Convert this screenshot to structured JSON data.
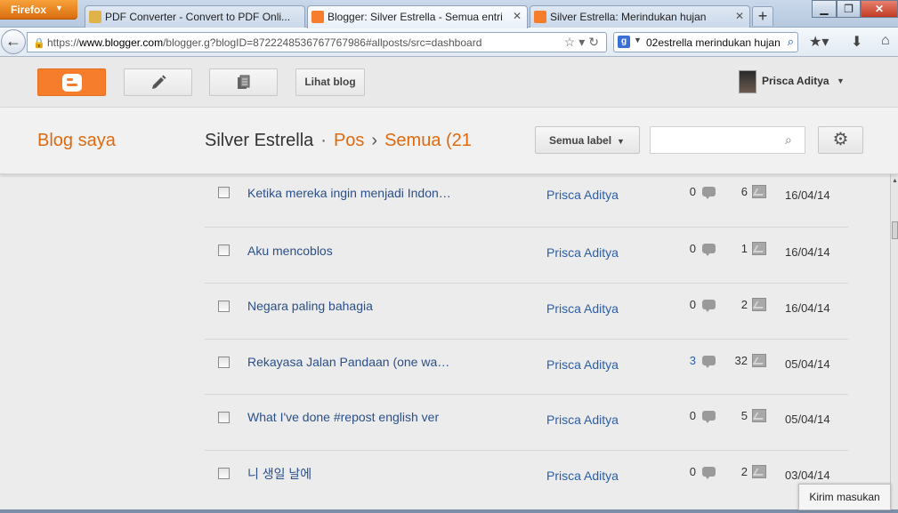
{
  "browser": {
    "menu_label": "Firefox",
    "tabs": [
      {
        "label": "PDF Converter - Convert to PDF Onli...",
        "favicon_color": "#e0b24a"
      },
      {
        "label": "Blogger: Silver Estrella - Semua entri",
        "favicon_color": "#f57d2c"
      },
      {
        "label": "Silver Estrella: Merindukan hujan",
        "favicon_color": "#f57d2c"
      }
    ],
    "url_prefix": "https://",
    "url_host": "www.blogger.com",
    "url_path": "/blogger.g?blogID=8722248536767767986#allposts/src=dashboard",
    "search_value": "02estrella merindukan hujan",
    "accent": "#f57d2c"
  },
  "header": {
    "view_blog_label": "Lihat blog",
    "user_name": "Prisca Aditya"
  },
  "subheader": {
    "my_blogs": "Blog saya",
    "blog_name": "Silver Estrella",
    "dot": "·",
    "crumb_posts": "Pos",
    "crumb_arrow": "›",
    "crumb_all": "Semua (21",
    "label_filter": "Semua label",
    "search_placeholder": ""
  },
  "posts": [
    {
      "title": "Ketika mereka ingin menjadi Indon…",
      "author": "Prisca Aditya",
      "comments": "0",
      "views": "6",
      "date": "16/04/14",
      "comments_link": false
    },
    {
      "title": "Aku mencoblos",
      "author": "Prisca Aditya",
      "comments": "0",
      "views": "1",
      "date": "16/04/14",
      "comments_link": false
    },
    {
      "title": "Negara paling bahagia",
      "author": "Prisca Aditya",
      "comments": "0",
      "views": "2",
      "date": "16/04/14",
      "comments_link": false
    },
    {
      "title": "Rekayasa Jalan Pandaan (one wa…",
      "author": "Prisca Aditya",
      "comments": "3",
      "views": "32",
      "date": "05/04/14",
      "comments_link": true
    },
    {
      "title": "What I've done #repost english ver",
      "author": "Prisca Aditya",
      "comments": "0",
      "views": "5",
      "date": "05/04/14",
      "comments_link": false
    },
    {
      "title": "니 생일 날에",
      "author": "Prisca Aditya",
      "comments": "0",
      "views": "2",
      "date": "03/04/14",
      "comments_link": false
    }
  ],
  "feedback_label": "Kirim masukan"
}
